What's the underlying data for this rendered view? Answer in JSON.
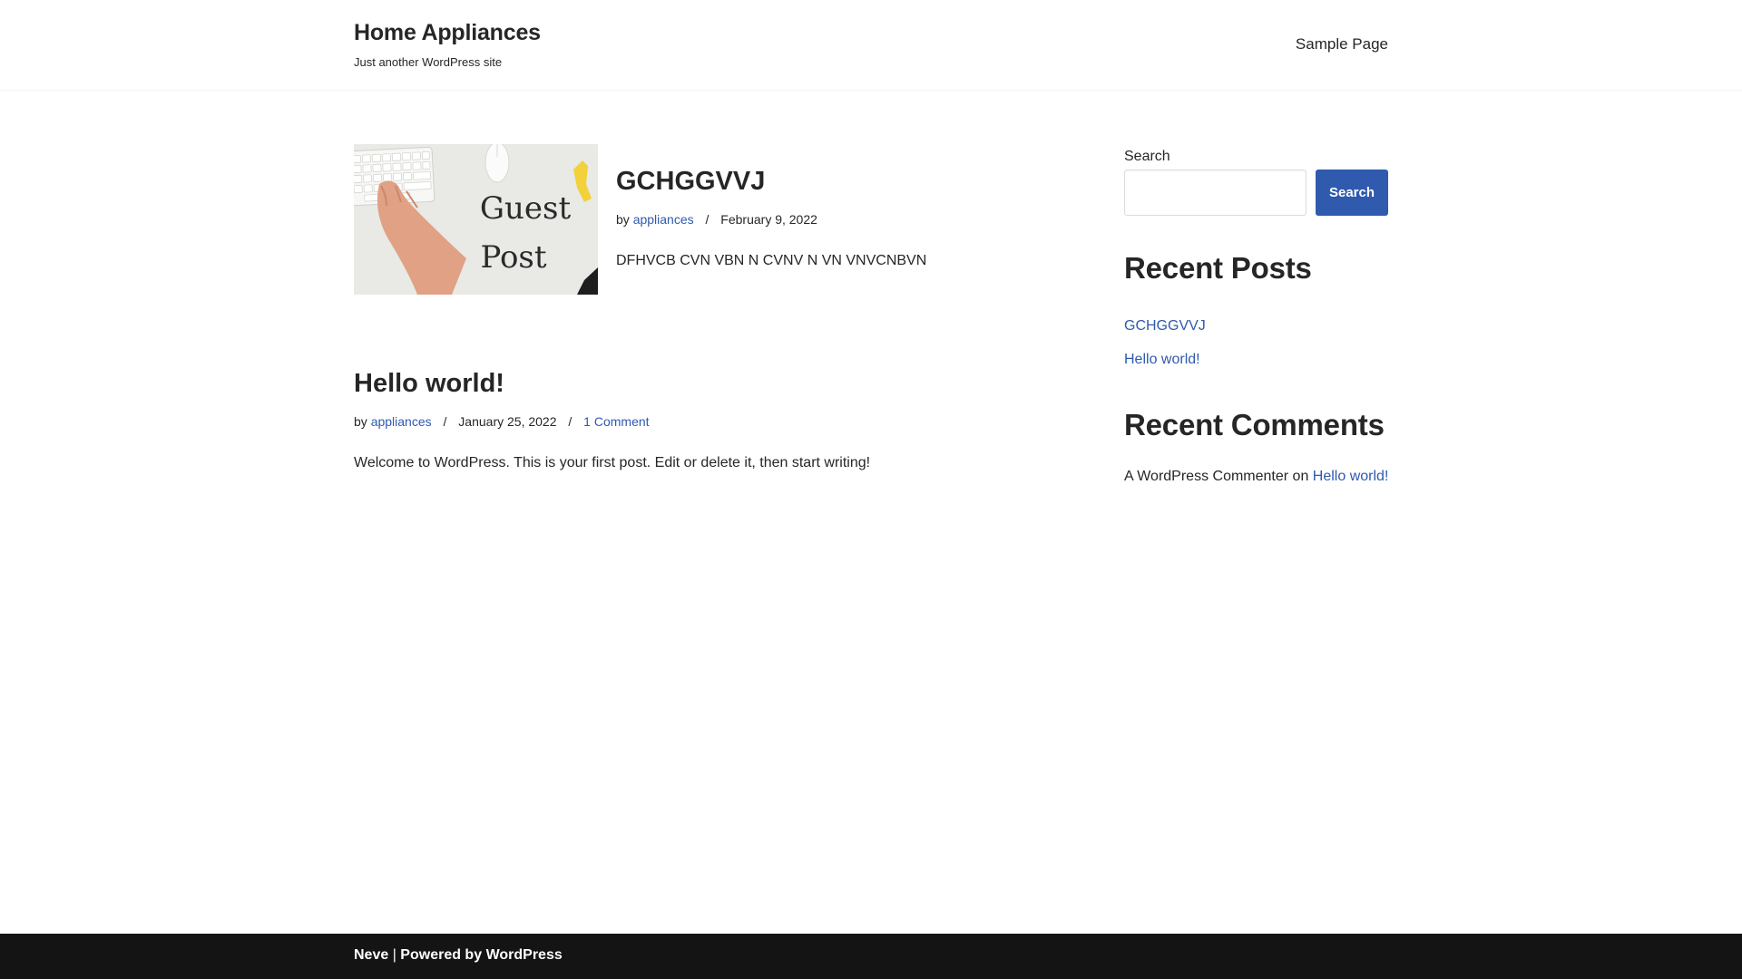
{
  "header": {
    "site_title": "Home Appliances",
    "site_description": "Just another WordPress site",
    "nav": {
      "sample_page": "Sample Page"
    }
  },
  "posts": [
    {
      "title": "GCHGGVVJ",
      "meta": {
        "by": "by",
        "author": "appliances",
        "separator": "/",
        "date": "February 9, 2022"
      },
      "excerpt": "DFHVCB CVN VBN N CVNV N VN VNVCNBVN",
      "thumbnail": {
        "alt_text_line1": "Guest",
        "alt_text_line2": "Post"
      }
    },
    {
      "title": "Hello world!",
      "meta": {
        "by": "by",
        "author": "appliances",
        "separator": "/",
        "date": "January 25, 2022",
        "comments": "1 Comment"
      },
      "excerpt": "Welcome to WordPress. This is your first post. Edit or delete it, then start writing!"
    }
  ],
  "sidebar": {
    "search": {
      "label": "Search",
      "placeholder": "",
      "button": "Search"
    },
    "recent_posts": {
      "title": "Recent Posts",
      "items": [
        "GCHGGVVJ",
        "Hello world!"
      ]
    },
    "recent_comments": {
      "title": "Recent Comments",
      "commenter": "A WordPress Commenter",
      "on": "on",
      "post_link": "Hello world!"
    }
  },
  "footer": {
    "theme": "Neve",
    "separator": " | ",
    "powered_by": "Powered by",
    "platform": "WordPress"
  },
  "colors": {
    "link": "#2f5aae",
    "text": "#272626",
    "footer_bg": "#141414",
    "button_bg": "#2f5aae"
  }
}
